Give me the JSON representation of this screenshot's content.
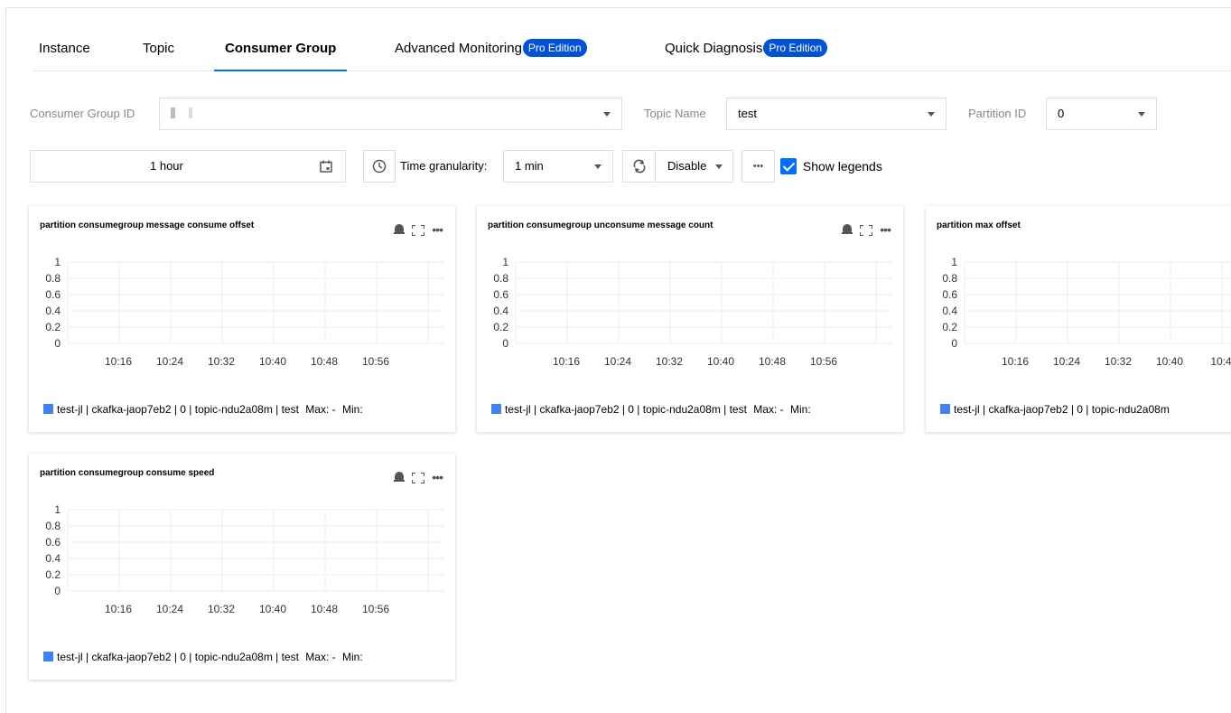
{
  "tabs": [
    {
      "label": "Instance"
    },
    {
      "label": "Topic"
    },
    {
      "label": "Consumer Group"
    },
    {
      "label": "Advanced Monitoring",
      "badge": "Pro Edition"
    },
    {
      "label": "Quick Diagnosis",
      "badge": "Pro Edition"
    }
  ],
  "filters": {
    "consumer_group_label": "Consumer Group ID",
    "consumer_group_value": "",
    "topic_label": "Topic Name",
    "topic_value": "test",
    "partition_label": "Partition ID",
    "partition_value": "0"
  },
  "controls": {
    "time_range": "1 hour",
    "granularity_label": "Time granularity:",
    "granularity_value": "1 min",
    "refresh_value": "Disable",
    "more": "•••",
    "show_legends_label": "Show legends"
  },
  "colors": {
    "accent": "#006eff",
    "badge": "#0052d9",
    "series": "#3d82f6"
  },
  "cards": [
    {
      "title": "partition consumegroup message consume offset",
      "legend": "test-jl | ckafka-jaop7eb2 | 0 | topic-ndu2a08m | test",
      "max": "Max: -",
      "min": "Min:"
    },
    {
      "title": "partition consumegroup unconsume message count",
      "legend": "test-jl | ckafka-jaop7eb2 | 0 | topic-ndu2a08m | test",
      "max": "Max: -",
      "min": "Min:"
    },
    {
      "title": "partition max offset",
      "legend": "test-jl | ckafka-jaop7eb2 | 0 | topic-ndu2a08m",
      "max": "",
      "min": ""
    },
    {
      "title": "partition consumegroup consume speed",
      "legend": "test-jl | ckafka-jaop7eb2 | 0 | topic-ndu2a08m | test",
      "max": "Max: -",
      "min": "Min:"
    }
  ],
  "chart_data": [
    {
      "type": "line",
      "title": "partition consumegroup message consume offset",
      "x": [
        "10:16",
        "10:24",
        "10:32",
        "10:40",
        "10:48",
        "10:56"
      ],
      "yticks": [
        "1",
        "0.8",
        "0.6",
        "0.4",
        "0.2",
        "0"
      ],
      "ylim": [
        0,
        1
      ],
      "grid": true,
      "series": []
    },
    {
      "type": "line",
      "title": "partition consumegroup unconsume message count",
      "x": [
        "10:16",
        "10:24",
        "10:32",
        "10:40",
        "10:48",
        "10:56"
      ],
      "yticks": [
        "1",
        "0.8",
        "0.6",
        "0.4",
        "0.2",
        "0"
      ],
      "ylim": [
        0,
        1
      ],
      "grid": true,
      "series": []
    },
    {
      "type": "line",
      "title": "partition max offset",
      "x": [
        "10:16",
        "10:24",
        "10:32",
        "10:40",
        "10:4"
      ],
      "yticks": [
        "1",
        "0.8",
        "0.6",
        "0.4",
        "0.2",
        "0"
      ],
      "ylim": [
        0,
        1
      ],
      "grid": true,
      "series": []
    },
    {
      "type": "line",
      "title": "partition consumegroup consume speed",
      "x": [
        "10:16",
        "10:24",
        "10:32",
        "10:40",
        "10:48",
        "10:56"
      ],
      "yticks": [
        "1",
        "0.8",
        "0.6",
        "0.4",
        "0.2",
        "0"
      ],
      "ylim": [
        0,
        1
      ],
      "grid": true,
      "series": []
    }
  ]
}
